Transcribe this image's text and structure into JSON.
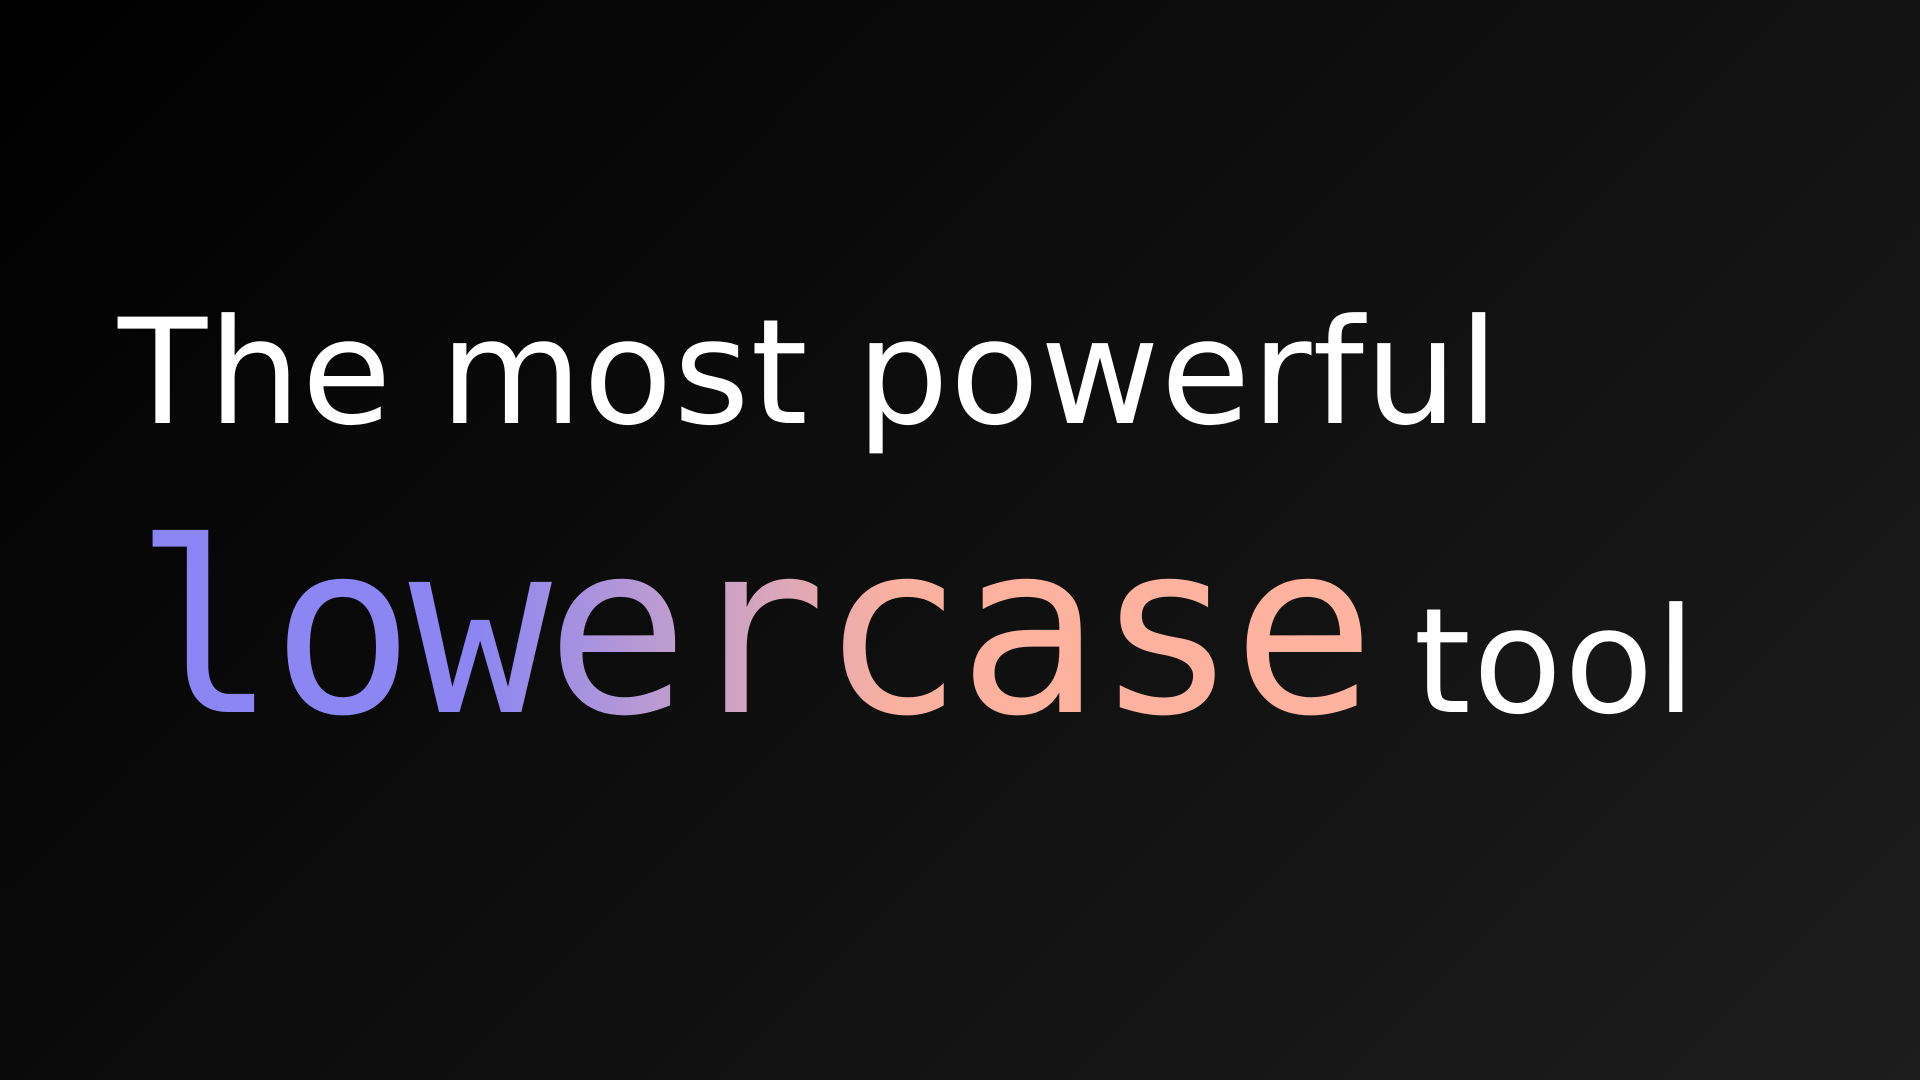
{
  "hero": {
    "line1": "The most powerful",
    "highlight": "lowercase",
    "tail": "tool"
  },
  "colors": {
    "background": "#0d0d0d",
    "text": "#ffffff",
    "gradient_start": "#8b85f4",
    "gradient_end": "#fdb39f"
  }
}
